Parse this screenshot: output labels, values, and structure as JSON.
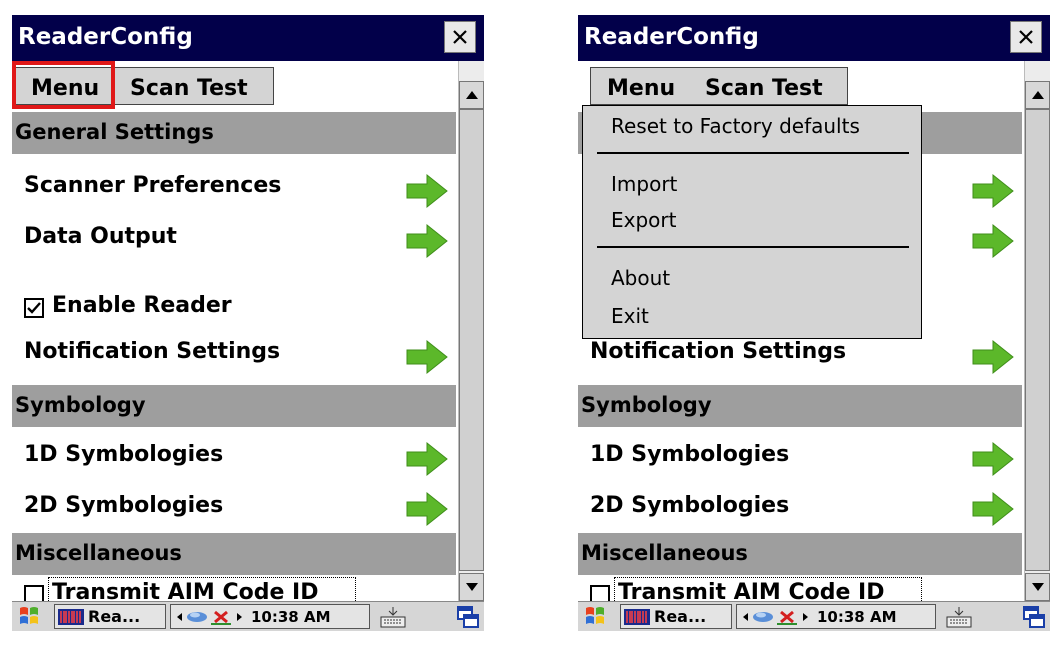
{
  "left_screen": {
    "title": "ReaderConfig",
    "menu": {
      "menu_label": "Menu",
      "scan_test_label": "Scan Test"
    },
    "sections": {
      "general": "General Settings",
      "symbology": "Symbology",
      "misc": "Miscellaneous"
    },
    "rows": {
      "scanner_prefs": "Scanner Preferences",
      "data_output": "Data Output",
      "enable_reader": "Enable Reader",
      "notification": "Notification Settings",
      "sym_1d": "1D Symbologies",
      "sym_2d": "2D Symbologies",
      "transmit_aim": "Transmit AIM Code ID"
    },
    "enable_reader_checked": true,
    "transmit_aim_checked": false,
    "taskbar": {
      "app_label": "Rea...",
      "clock": "10:38 AM"
    }
  },
  "right_screen": {
    "title": "ReaderConfig",
    "menu": {
      "menu_label": "Menu",
      "scan_test_label": "Scan Test"
    },
    "dropdown": {
      "reset": "Reset to Factory defaults",
      "import": "Import",
      "export": "Export",
      "about": "About",
      "exit": "Exit"
    },
    "rows": {
      "notification_partial": "Notification Settings",
      "sym_1d": "1D Symbologies",
      "sym_2d": "2D Symbologies",
      "transmit_aim": "Transmit AIM Code ID"
    },
    "sections": {
      "symbology": "Symbology",
      "misc": "Miscellaneous"
    },
    "taskbar": {
      "app_label": "Rea...",
      "clock": "10:38 AM"
    }
  },
  "colors": {
    "titlebar": "#02004a",
    "section_header": "#9e9e9e",
    "menu_highlight": "#e01818",
    "arrow_green": "#5cb82a"
  },
  "icons": [
    "close-icon",
    "arrow-right-icon",
    "checkbox-icon",
    "windows-start-icon",
    "keyboard-icon",
    "window-switch-icon",
    "network-icon"
  ]
}
